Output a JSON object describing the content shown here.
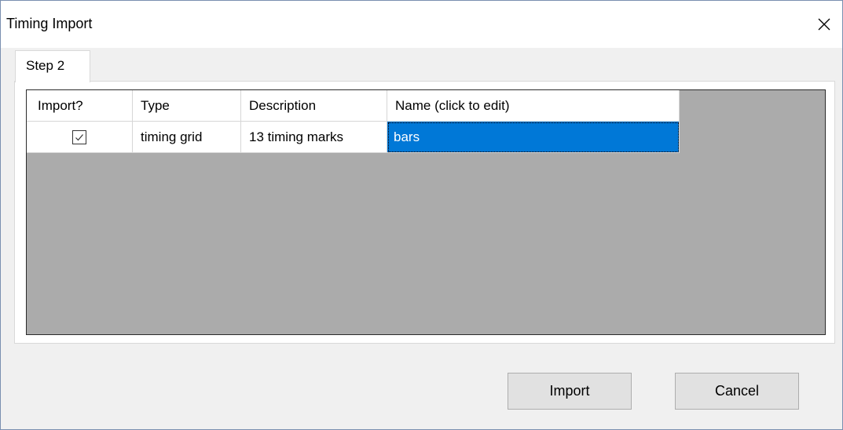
{
  "window": {
    "title": "Timing Import",
    "close_icon": "close-icon"
  },
  "tabs": [
    {
      "label": "Step 2",
      "active": true
    }
  ],
  "grid": {
    "columns": [
      "Import?",
      "Type",
      "Description",
      "Name (click to edit)"
    ],
    "rows": [
      {
        "import_checked": true,
        "type": "timing grid",
        "description": "13 timing marks",
        "name": "bars"
      }
    ],
    "selection_color": "#0078d7",
    "background_color": "#ababab"
  },
  "buttons": {
    "import_label": "Import",
    "cancel_label": "Cancel"
  }
}
